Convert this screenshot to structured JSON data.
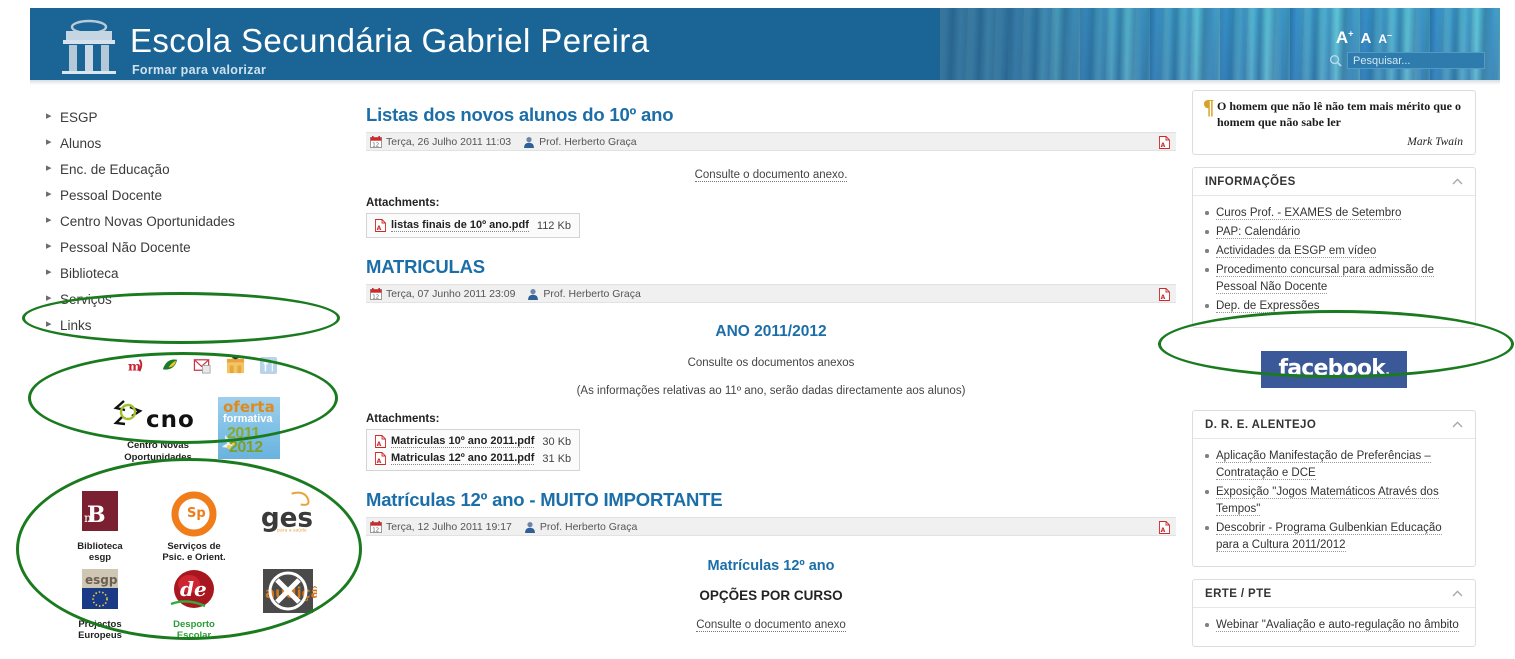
{
  "header": {
    "site_title": "Escola Secundária Gabriel Pereira",
    "tagline": "Formar para valorizar",
    "font_larger": "A",
    "font_normal": "A",
    "font_smaller": "A",
    "font_larger_sup": "+",
    "font_smaller_sup": "–",
    "search_placeholder": "Pesquisar...",
    "search_value": "",
    "bg_color": "#1a6496"
  },
  "sidebar": {
    "menu": [
      {
        "label": "ESGP"
      },
      {
        "label": "Alunos"
      },
      {
        "label": "Enc. de Educação"
      },
      {
        "label": "Pessoal Docente"
      },
      {
        "label": "Centro Novas Oportunidades"
      },
      {
        "label": "Pessoal Não Docente"
      },
      {
        "label": "Biblioteca"
      },
      {
        "label": "Serviços"
      },
      {
        "label": "Links"
      }
    ],
    "tiny_icons": [
      {
        "name": "moodle-icon"
      },
      {
        "name": "leaf-eco-escolas-icon"
      },
      {
        "name": "webmail-icon"
      },
      {
        "name": "graduation-shop-icon"
      },
      {
        "name": "cutlery-cantina-icon"
      }
    ],
    "cno": {
      "logo_text": "cno",
      "caption_line1": "Centro Novas",
      "caption_line2": "Oportunidades"
    },
    "oferta": {
      "line1": "oferta",
      "line2": "formativa",
      "line3": "2011",
      "line4": "2012"
    },
    "logos": [
      {
        "name": "biblioteca-esgp-logo",
        "mark": "B",
        "caption_line1": "Biblioteca",
        "caption_line2": "esgp"
      },
      {
        "name": "servicos-psicologia-logo",
        "mark": "Sp",
        "caption_line1": "Serviços de",
        "caption_line2": "Psic. e Orient."
      },
      {
        "name": "ges-logo",
        "mark": "ges",
        "caption_line1": "",
        "caption_line2": ""
      },
      {
        "name": "projectos-europeus-logo",
        "mark": "esgp",
        "caption_line1": "Projectos",
        "caption_line2": "Europeus"
      },
      {
        "name": "desporto-escolar-logo",
        "mark": "de",
        "caption_line1": "Desporto",
        "caption_line2": "Escolar"
      },
      {
        "name": "auticao-logo",
        "mark": "auticão",
        "caption_line1": "",
        "caption_line2": ""
      }
    ]
  },
  "main": {
    "articles": [
      {
        "title": "Listas dos novos alunos do 10º ano",
        "date": "Terça, 26 Julho 2011 11:03",
        "author": "Prof. Herberto Graça",
        "intro": "Consulte o documento anexo.",
        "heading_blue": "",
        "note": "",
        "sub_blue": "",
        "sub_dark": "",
        "attachments_label": "Attachments:",
        "attachments": [
          {
            "name": "listas finais de 10º ano.pdf",
            "size": "112 Kb"
          }
        ]
      },
      {
        "title": "MATRICULAS",
        "date": "Terça, 07 Junho 2011 23:09",
        "author": "Prof. Herberto Graça",
        "heading_blue": "ANO 2011/2012",
        "intro": "Consulte os documentos anexos",
        "note": "(As informações relativas ao 11º ano, serão dadas directamente aos alunos)",
        "sub_blue": "",
        "sub_dark": "",
        "attachments_label": "Attachments:",
        "attachments": [
          {
            "name": "Matriculas 10º ano 2011.pdf",
            "size": "30 Kb"
          },
          {
            "name": "Matriculas 12º ano 2011.pdf",
            "size": "31 Kb"
          }
        ]
      },
      {
        "title": "Matrículas 12º ano - MUITO IMPORTANTE",
        "date": "Terça, 12 Julho 2011 19:17",
        "author": "Prof. Herberto Graça",
        "heading_blue": "",
        "sub_blue": "Matrículas 12º ano",
        "sub_dark": "OPÇÕES POR CURSO",
        "intro": "Consulte o documento anexo",
        "note": "",
        "attachments_label": "",
        "attachments": []
      }
    ]
  },
  "right": {
    "quote": {
      "text": "O homem que não lê não tem mais mérito que o homem que não sabe ler",
      "author": "Mark Twain"
    },
    "modules": [
      {
        "title": "INFORMAÇÕES",
        "items": [
          "Curos Prof. - EXAMES de Setembro",
          "PAP: Calendário",
          "Actividades da ESGP em vídeo",
          "Procedimento concursal para admissão de Pessoal Não Docente",
          "Dep. de Expressões"
        ]
      },
      {
        "title": "D. R. E. ALENTEJO",
        "items": [
          "Aplicação Manifestação de Preferências – Contratação e DCE",
          "Exposição \"Jogos Matemáticos Através dos Tempos\"",
          "Descobrir - Programa Gulbenkian Educação para a Cultura 2011/2012"
        ]
      },
      {
        "title": "ERTE / PTE",
        "items": [
          "Webinar \"Avaliação e auto-regulação no âmbito"
        ]
      }
    ],
    "facebook": {
      "label": "facebook",
      "dot": ".",
      "color": "#3b5998"
    }
  },
  "annotations": {
    "color": "#1a7a1e",
    "ellipses": [
      {
        "name": "annotation-ellipse-tiny-icons"
      },
      {
        "name": "annotation-ellipse-cno-banners"
      },
      {
        "name": "annotation-ellipse-partner-logos"
      },
      {
        "name": "annotation-ellipse-facebook"
      }
    ]
  }
}
